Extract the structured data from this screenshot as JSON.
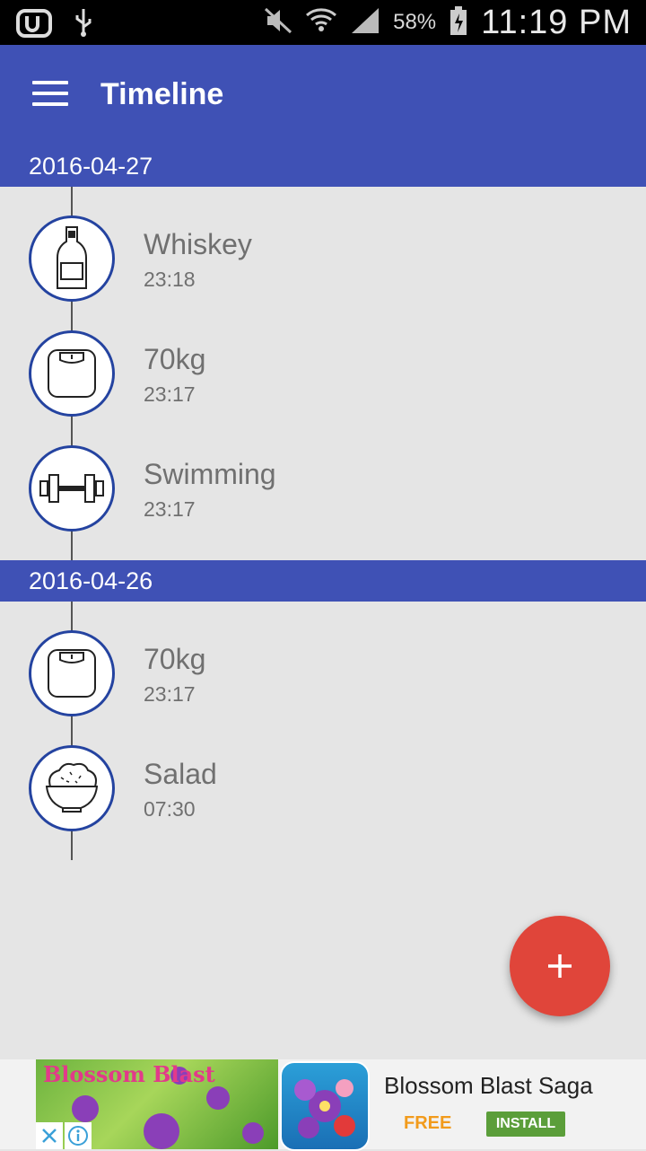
{
  "status_bar": {
    "battery": "58%",
    "time": "11:19 PM"
  },
  "app_bar": {
    "title": "Timeline"
  },
  "groups": [
    {
      "date": "2016-04-27",
      "entries": [
        {
          "label": "Whiskey",
          "time": "23:18",
          "icon": "bottle-icon"
        },
        {
          "label": "70kg",
          "time": "23:17",
          "icon": "scale-icon"
        },
        {
          "label": "Swimming",
          "time": "23:17",
          "icon": "dumbbell-icon"
        }
      ]
    },
    {
      "date": "2016-04-26",
      "entries": [
        {
          "label": "70kg",
          "time": "23:17",
          "icon": "scale-icon"
        },
        {
          "label": "Salad",
          "time": "07:30",
          "icon": "rice-bowl-icon"
        }
      ]
    }
  ],
  "fab": {
    "icon": "plus-icon"
  },
  "ad": {
    "title": "Blossom Blast Saga",
    "price": "FREE",
    "install_label": "INSTALL",
    "image_logo_text": "Blossom Blast"
  },
  "colors": {
    "primary": "#3f51b5",
    "accent": "#e0453a",
    "circle_border": "#2443a0",
    "background": "#e5e5e5"
  }
}
